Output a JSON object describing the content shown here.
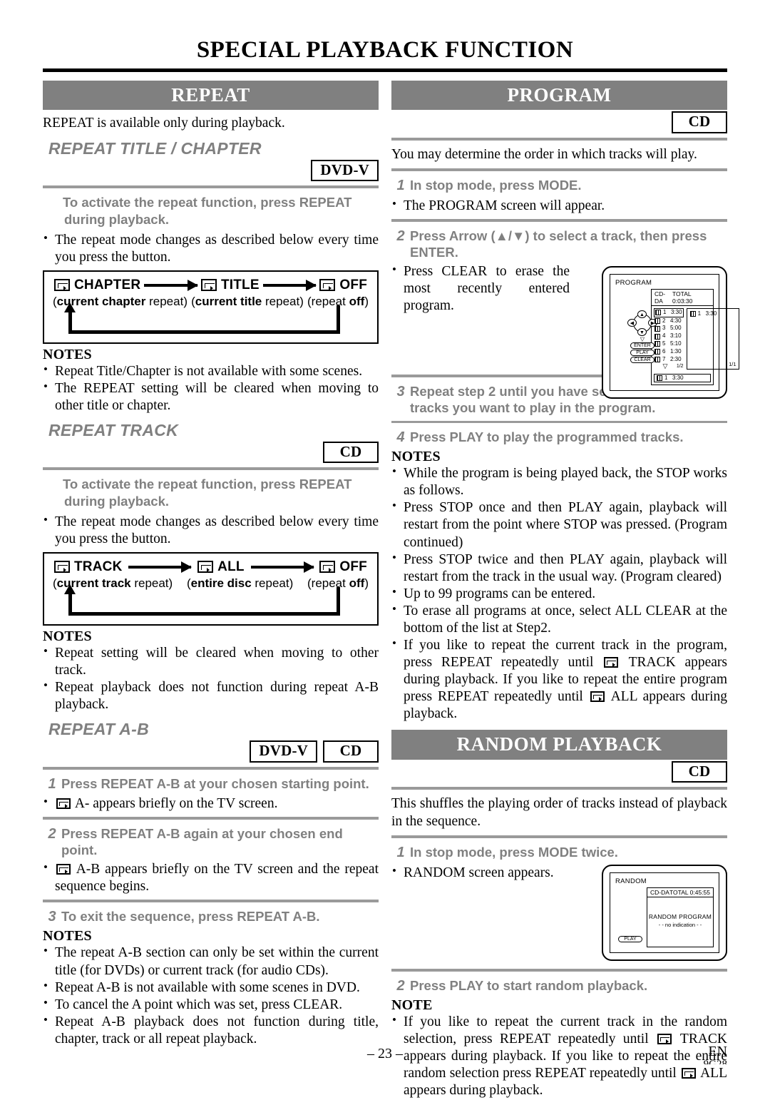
{
  "document": {
    "title": "SPECIAL PLAYBACK FUNCTION",
    "page_number": "– 23 –",
    "language_code": "EN",
    "doc_code": "9G28"
  },
  "badges": {
    "dvd_v": "DVD-V",
    "cd": "CD"
  },
  "repeat_section": {
    "banner": "REPEAT",
    "intro": "REPEAT is available only during playback.",
    "title_chapter": {
      "heading": "REPEAT TITLE / CHAPTER",
      "badge": "DVD-V",
      "activate": "To activate the repeat function, press REPEAT during playback.",
      "bullet": "The repeat mode changes as described below every time you press the button.",
      "cycle": {
        "items": [
          {
            "label": "CHAPTER",
            "sub_bold": "current chapter",
            "sub_rest": " repeat"
          },
          {
            "label": "TITLE",
            "sub_bold": "current title",
            "sub_rest": " repeat"
          },
          {
            "label": "OFF",
            "sub_pre": "repeat ",
            "sub_bold2": "off"
          }
        ]
      },
      "notes_head": "NOTES",
      "notes": [
        "Repeat Title/Chapter is not available with some scenes.",
        "The REPEAT setting will be cleared when moving to other title or chapter."
      ]
    },
    "track": {
      "heading": "REPEAT TRACK",
      "badge": "CD",
      "activate": "To activate the repeat function, press REPEAT during playback.",
      "bullet": "The repeat mode changes as described below every time you press the button.",
      "cycle": {
        "items": [
          {
            "label": "TRACK",
            "sub_bold": "current track",
            "sub_rest": " repeat"
          },
          {
            "label": "ALL",
            "sub_bold": "entire disc",
            "sub_rest": " repeat"
          },
          {
            "label": "OFF",
            "sub_pre": "repeat ",
            "sub_bold2": "off"
          }
        ]
      },
      "notes_head": "NOTES",
      "notes": [
        "Repeat setting will be cleared when moving to other track.",
        "Repeat playback does not function during repeat A-B playback."
      ]
    },
    "ab": {
      "heading": "REPEAT A-B",
      "badge_dvd": "DVD-V",
      "badge_cd": "CD",
      "step1_num": "1",
      "step1": "Press REPEAT A-B at your chosen starting point.",
      "bullet1_pre": "",
      "bullet1_post": "A- appears briefly on the TV screen.",
      "step2_num": "2",
      "step2": "Press REPEAT A-B again at your chosen end point.",
      "bullet2_post": "A-B appears briefly on the TV screen and the repeat sequence begins.",
      "step3_num": "3",
      "step3": "To exit the sequence, press REPEAT A-B.",
      "notes_head": "NOTES",
      "notes": [
        "The repeat A-B section can only be set within the current title (for DVDs) or current track (for audio CDs).",
        "Repeat A-B is not available with some scenes in DVD.",
        "To cancel the A point which was set, press CLEAR.",
        "Repeat A-B playback does not function during title, chapter, track or all repeat playback."
      ]
    }
  },
  "program_section": {
    "banner": "PROGRAM",
    "badge": "CD",
    "intro": "You may determine the order in which tracks will play.",
    "step1_num": "1",
    "step1": "In stop mode, press MODE.",
    "bullet1": "The PROGRAM screen will appear.",
    "step2_num": "2",
    "step2": "Press Arrow (▲/▼) to select a track, then press ENTER.",
    "bullet2": "Press CLEAR to erase the most recently entered program.",
    "step3_num": "3",
    "step3": "Repeat step 2 until you have selected all the tracks you want to play in the program.",
    "step4_num": "4",
    "step4": "Press PLAY to play the programmed tracks.",
    "notes_head": "NOTES",
    "notes": [
      "While the program is being played back, the STOP works as follows.",
      "Press STOP once and then PLAY again, playback will restart from the point where STOP was pressed. (Program continued)",
      "Press STOP twice and then PLAY again, playback will restart from the track in the usual way. (Program cleared)",
      "Up to 99 programs can be entered.",
      "To erase all programs at once, select ALL CLEAR at the bottom of the list at Step2."
    ],
    "note_repeat_a": "If you like to repeat the current track in the program, press REPEAT repeatedly until",
    "note_repeat_b": "TRACK appears during playback. If you like to repeat the entire program press REPEAT repeatedly until",
    "note_repeat_c": "ALL appears during playback.",
    "osd": {
      "screen_title": "PROGRAM",
      "disc_type": "CD-DA",
      "total_label": "TOTAL 0:03:30",
      "tracks": [
        {
          "no": "1",
          "time": "3:30",
          "selected": true
        },
        {
          "no": "2",
          "time": "4:30",
          "selected": false
        },
        {
          "no": "3",
          "time": "5:00",
          "selected": false
        },
        {
          "no": "4",
          "time": "3:10",
          "selected": false
        },
        {
          "no": "5",
          "time": "5:10",
          "selected": false
        },
        {
          "no": "6",
          "time": "1:30",
          "selected": false
        },
        {
          "no": "7",
          "time": "2:30",
          "selected": false
        }
      ],
      "list_page": "1/2",
      "program_page": "1/1",
      "programmed": {
        "no": "1",
        "time": "3:30"
      },
      "footer_entry": {
        "no": "1",
        "time": "3:30"
      },
      "keys": {
        "enter": "ENTER",
        "play": "PLAY",
        "clear": "CLEAR"
      },
      "dpad": {
        "up": "▲",
        "down": "▼",
        "left": "◀",
        "right": "▶"
      }
    }
  },
  "random_section": {
    "banner": "RANDOM PLAYBACK",
    "badge": "CD",
    "intro": "This shuffles the playing order of tracks instead of playback in the sequence.",
    "step1_num": "1",
    "step1": "In stop mode, press MODE twice.",
    "bullet1": "RANDOM screen appears.",
    "step2_num": "2",
    "step2": "Press PLAY to start random playback.",
    "note_head": "NOTE",
    "note_a": "If you like to repeat the current track in the random selection, press REPEAT repeatedly until",
    "note_b": "TRACK appears during playback. If you like to repeat the entire random selection press REPEAT repeatedly until",
    "note_c": "ALL appears during playback.",
    "osd": {
      "screen_title": "RANDOM",
      "disc_type": "CD-DA",
      "total_label": "TOTAL 0:45:55",
      "center_line1": "RANDOM PROGRAM",
      "center_line2": "- - no indication - -",
      "play_key": "PLAY"
    }
  },
  "colors": {
    "banner_gray": "#808080",
    "rule_gray": "#9a9a9a",
    "text_black": "#000000"
  }
}
